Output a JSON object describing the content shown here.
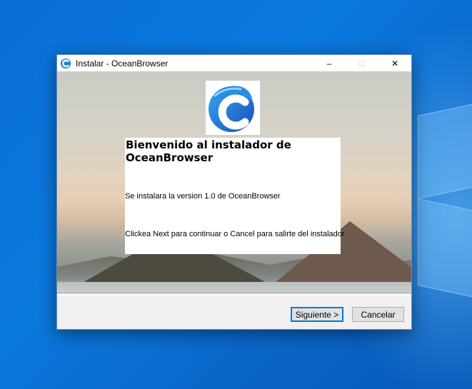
{
  "window": {
    "title": "Instalar - OceanBrowser",
    "controls": {
      "minimize": "–",
      "maximize": "□",
      "close": "✕"
    }
  },
  "content": {
    "heading": "Bienvenido al instalador de OceanBrowser",
    "line1": "Se instalara la version 1.0 de OceanBrowser",
    "line2": "Clickea Next para continuar o Cancel para salirte del instalador"
  },
  "buttons": {
    "next": "Siguiente >",
    "cancel": "Cancelar"
  },
  "colors": {
    "accent": "#0078d7",
    "logo_primary": "#1a7fd6",
    "desktop": "#0a6fd6"
  },
  "icons": {
    "app": "oceanbrowser-logo-icon",
    "logo": "oceanbrowser-logo"
  }
}
